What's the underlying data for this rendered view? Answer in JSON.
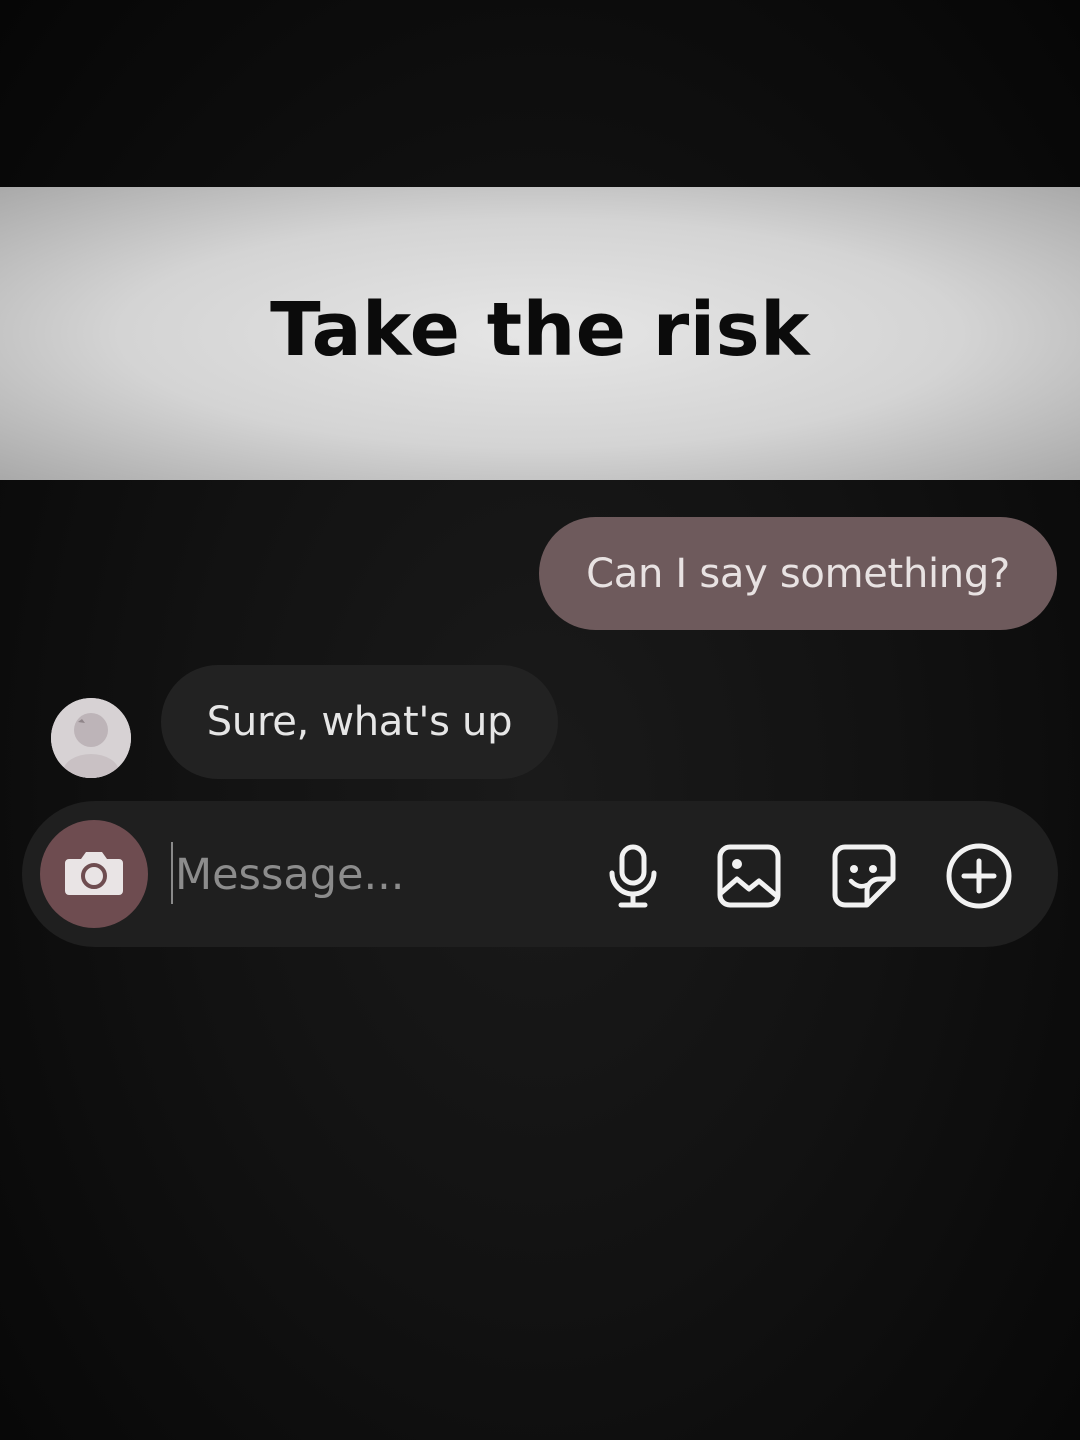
{
  "banner": {
    "title": "Take the risk"
  },
  "chat": {
    "messages": [
      {
        "from": "me",
        "text": "Can I say something?"
      },
      {
        "from": "them",
        "text": "Sure, what's up"
      }
    ]
  },
  "composer": {
    "placeholder": "Message...",
    "value": "",
    "icons": [
      "camera-icon",
      "microphone-icon",
      "gallery-icon",
      "sticker-icon",
      "plus-circle-icon"
    ]
  },
  "colors": {
    "sent_bubble": "#6e5a5c",
    "received_bubble": "#222222",
    "camera_button": "#6e4c50",
    "background": "#121212"
  }
}
